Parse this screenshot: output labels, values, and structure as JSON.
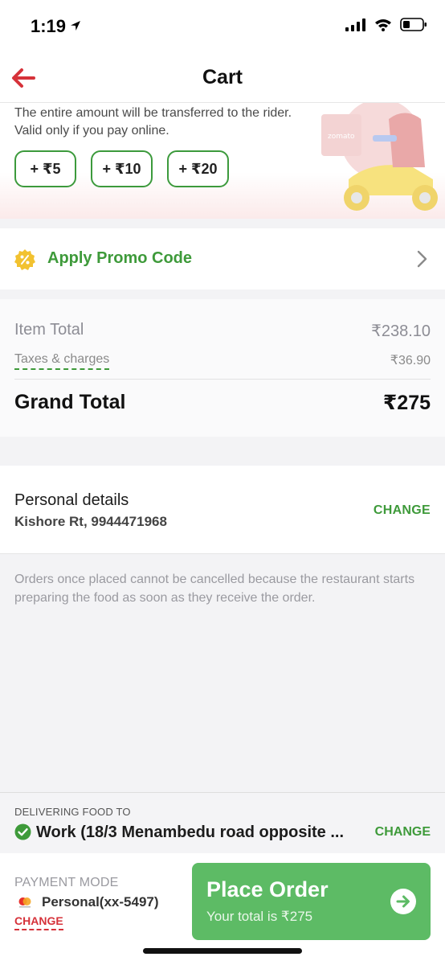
{
  "status_bar": {
    "time": "1:19"
  },
  "header": {
    "title": "Cart"
  },
  "tip": {
    "line1": "The entire amount will be transferred to the rider.",
    "line2": "Valid only if you pay online.",
    "options": [
      "+ ₹5",
      "+ ₹10",
      "+ ₹20"
    ],
    "brand": "zomato"
  },
  "promo": {
    "label": "Apply Promo Code"
  },
  "bill": {
    "item_total_label": "Item Total",
    "item_total_value": "₹238.10",
    "taxes_label": "Taxes & charges",
    "taxes_value": "₹36.90",
    "grand_total_label": "Grand Total",
    "grand_total_value": "₹275"
  },
  "personal": {
    "title": "Personal details",
    "subtitle": "Kishore Rt, 9944471968",
    "change_label": "CHANGE"
  },
  "cancel_note": "Orders once placed cannot be cancelled because the restaurant starts preparing the food as soon as they receive the order.",
  "delivery": {
    "label": "DELIVERING FOOD TO",
    "address": "Work (18/3 Menambedu road opposite ...",
    "change_label": "CHANGE"
  },
  "payment": {
    "label": "PAYMENT MODE",
    "card": "Personal(xx-5497)",
    "change_label": "CHANGE",
    "place_order_label": "Place Order",
    "total_label": "Your total is ₹275"
  },
  "colors": {
    "accent_green": "#3e9a3a",
    "button_green": "#5dbb65",
    "red": "#d6323a"
  }
}
